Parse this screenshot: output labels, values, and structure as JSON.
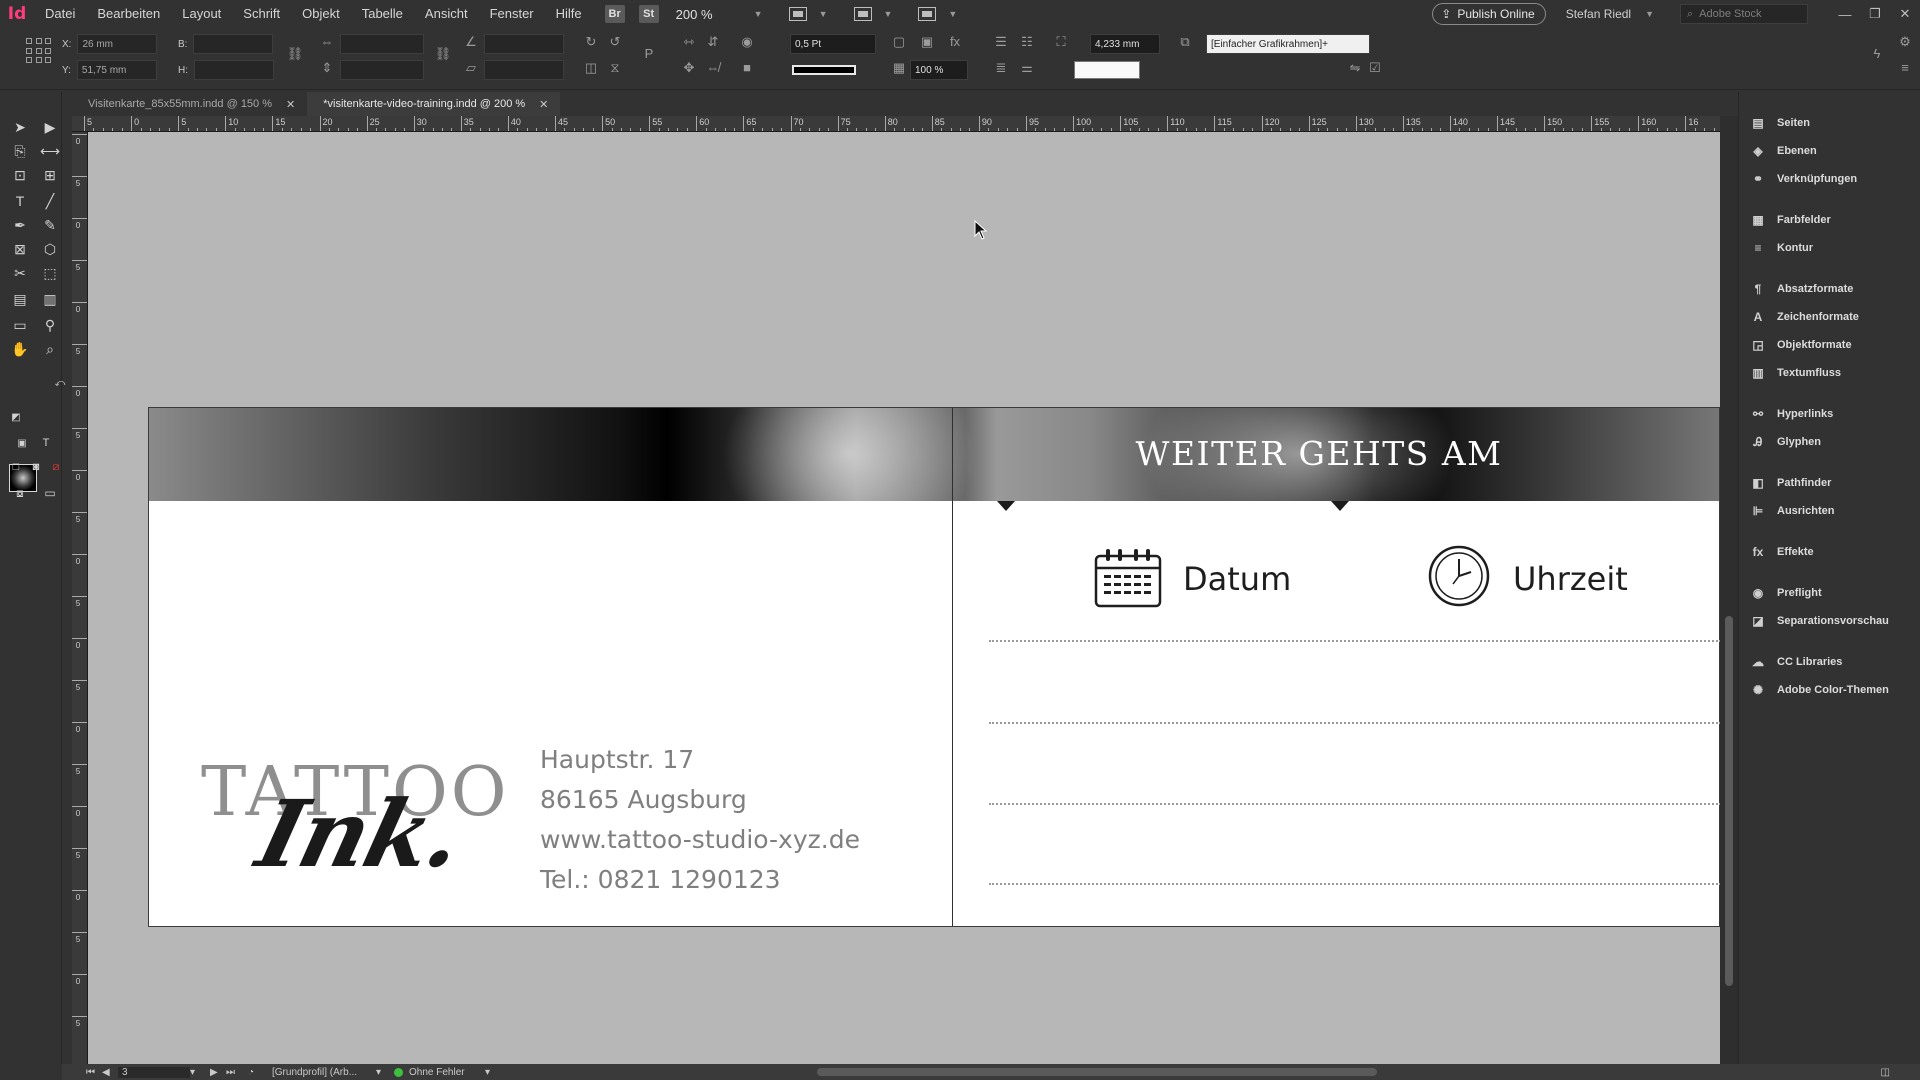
{
  "app": {
    "logo": "Id"
  },
  "menu": [
    "Datei",
    "Bearbeiten",
    "Layout",
    "Schrift",
    "Objekt",
    "Tabelle",
    "Ansicht",
    "Fenster",
    "Hilfe"
  ],
  "menubar": {
    "bridge": "Br",
    "stock": "St",
    "zoom": "200 %",
    "publish_label": "Publish Online",
    "user": "Stefan Riedl",
    "search_placeholder": "Adobe Stock"
  },
  "control": {
    "x_label": "X:",
    "x_value": "26 mm",
    "y_label": "Y:",
    "y_value": "51,75 mm",
    "w_label": "B:",
    "h_label": "H:",
    "stroke_weight": "0,5 Pt",
    "opacity": "100 %",
    "frame_offset": "4,233 mm",
    "object_style": "[Einfacher Grafikrahmen]+"
  },
  "tabs": [
    {
      "label": "Visitenkarte_85x55mm.indd @ 150 %",
      "active": false
    },
    {
      "label": "*visitenkarte-video-training.indd @ 200 %",
      "active": true
    }
  ],
  "ruler_h": [
    "5",
    "0",
    "5",
    "10",
    "15",
    "20",
    "25",
    "30",
    "35",
    "40",
    "45",
    "50",
    "55",
    "60",
    "65",
    "70",
    "75",
    "80",
    "85",
    "90",
    "95",
    "100",
    "105",
    "110",
    "115",
    "120",
    "125",
    "130",
    "135",
    "140",
    "145",
    "150",
    "155",
    "160",
    "16"
  ],
  "ruler_v": [
    "0",
    "5",
    "0",
    "5",
    "0",
    "5",
    "0",
    "5",
    "0",
    "5",
    "0",
    "5",
    "0",
    "5",
    "0",
    "5",
    "0",
    "5",
    "0",
    "5",
    "0",
    "5"
  ],
  "document": {
    "banner": "WEITER GEHTS AM",
    "date_label": "Datum",
    "time_label": "Uhrzeit",
    "logo_top": "TATTOO",
    "logo_script": "Ink.",
    "address": [
      "Hauptstr. 17",
      "86165 Augsburg",
      "www.tattoo-studio-xyz.de",
      "Tel.: 0821 1290123"
    ]
  },
  "panels": [
    {
      "label": "Seiten",
      "icon": "pages-icon"
    },
    {
      "label": "Ebenen",
      "icon": "layers-icon"
    },
    {
      "label": "Verknüpfungen",
      "icon": "links-icon"
    },
    {
      "label": "Farbfelder",
      "icon": "swatches-icon"
    },
    {
      "label": "Kontur",
      "icon": "stroke-icon"
    },
    {
      "label": "Absatzformate",
      "icon": "paragraph-styles-icon"
    },
    {
      "label": "Zeichenformate",
      "icon": "character-styles-icon"
    },
    {
      "label": "Objektformate",
      "icon": "object-styles-icon"
    },
    {
      "label": "Textumfluss",
      "icon": "text-wrap-icon"
    },
    {
      "label": "Hyperlinks",
      "icon": "hyperlinks-icon"
    },
    {
      "label": "Glyphen",
      "icon": "glyphs-icon"
    },
    {
      "label": "Pathfinder",
      "icon": "pathfinder-icon"
    },
    {
      "label": "Ausrichten",
      "icon": "align-icon"
    },
    {
      "label": "Effekte",
      "icon": "effects-icon"
    },
    {
      "label": "Preflight",
      "icon": "preflight-icon"
    },
    {
      "label": "Separationsvorschau",
      "icon": "separations-icon"
    },
    {
      "label": "CC Libraries",
      "icon": "cc-libraries-icon"
    },
    {
      "label": "Adobe Color-Themen",
      "icon": "color-themes-icon"
    }
  ],
  "status": {
    "page": "3",
    "profile": "[Grundprofil] (Arb...",
    "preflight": "Ohne Fehler"
  },
  "colors": {
    "accent": "#ff3c7d",
    "preflight_ok": "#3ec23e",
    "pasteboard": "#b7b7b7"
  }
}
